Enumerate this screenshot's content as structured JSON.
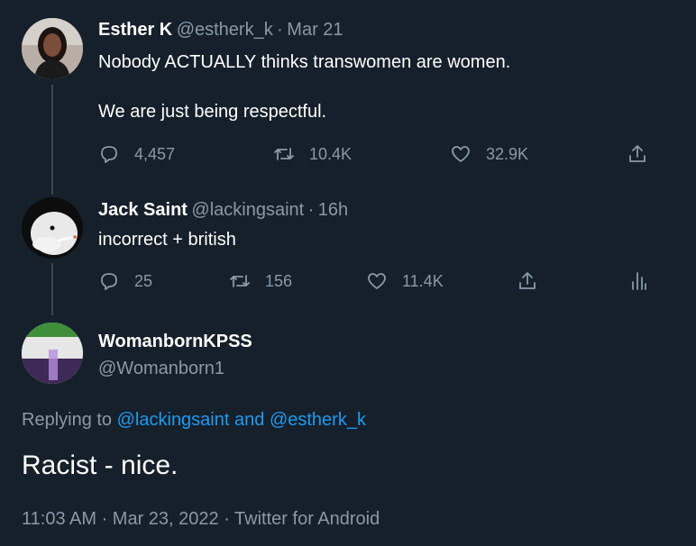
{
  "tweets": [
    {
      "name": "Esther K",
      "handle": "@estherk_k",
      "date": "Mar 21",
      "line1": "Nobody ACTUALLY thinks transwomen are women.",
      "line2": "We are just being respectful.",
      "replies": "4,457",
      "retweets": "10.4K",
      "likes": "32.9K"
    },
    {
      "name": "Jack Saint",
      "handle": "@lackingsaint",
      "date": "16h",
      "line1": "incorrect + british",
      "replies": "25",
      "retweets": "156",
      "likes": "11.4K"
    }
  ],
  "main": {
    "name": "WomanbornKPSS",
    "handle": "@Womanborn1",
    "replying_prefix": "Replying to",
    "replying_user1": "@lackingsaint",
    "replying_and": "and",
    "replying_user2": "@estherk_k",
    "text": "Racist - nice.",
    "timestamp": "11:03 AM · Mar 23, 2022 · Twitter for Android"
  },
  "colors": {
    "background": "#15202b",
    "muted": "#8b98a5",
    "accent": "#1d9bf0",
    "thread_line": "#38444d"
  },
  "icons": [
    "reply-icon",
    "retweet-icon",
    "like-icon",
    "share-icon",
    "analytics-icon"
  ]
}
